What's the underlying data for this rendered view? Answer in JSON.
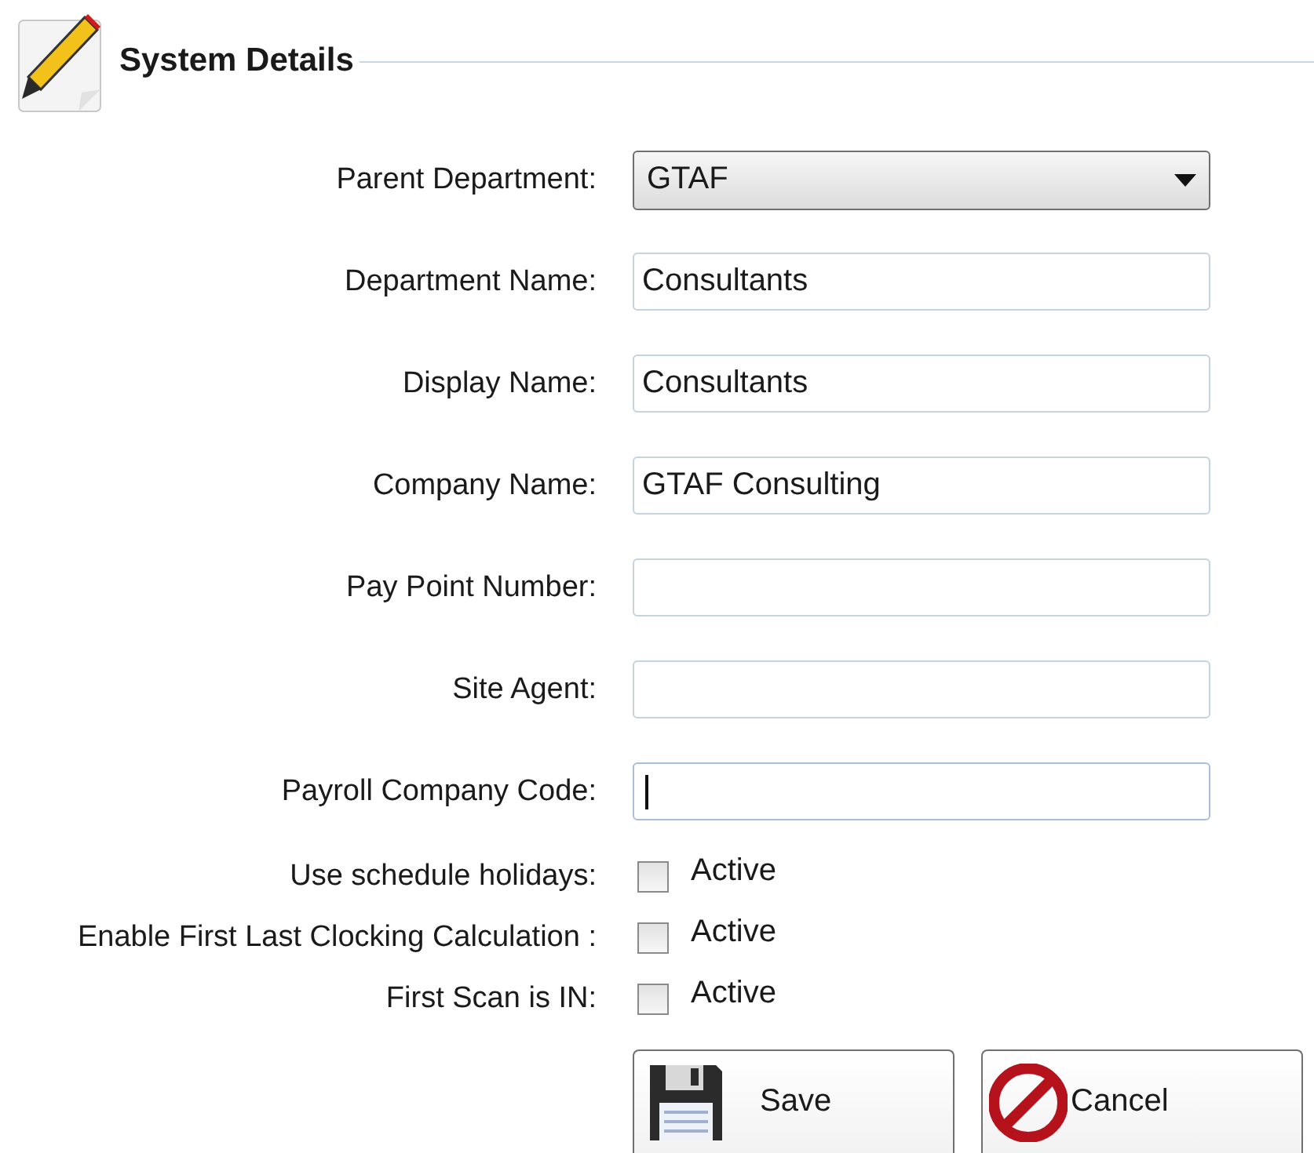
{
  "section": {
    "title": "System Details"
  },
  "fields": [
    {
      "label": "Parent Department:",
      "kind": "dropdown",
      "value": "GTAF"
    },
    {
      "label": "Department Name:",
      "kind": "text",
      "value": "Consultants"
    },
    {
      "label": "Display Name:",
      "kind": "text",
      "value": "Consultants"
    },
    {
      "label": "Company Name:",
      "kind": "text",
      "value": "GTAF Consulting"
    },
    {
      "label": "Pay Point Number:",
      "kind": "text"
    },
    {
      "label": "Site Agent:",
      "kind": "text"
    },
    {
      "label": "Payroll Company Code:",
      "kind": "text",
      "focused": true
    }
  ],
  "checkboxes": [
    {
      "label": "Use schedule holidays:",
      "text": "Active",
      "checked": false
    },
    {
      "label": "Enable First Last Clocking Calculation :",
      "text": "Active",
      "checked": false
    },
    {
      "label": "First Scan is IN:",
      "text": "Active",
      "checked": false
    }
  ],
  "buttons": [
    {
      "label": "Save",
      "kind": "save"
    },
    {
      "label": "Cancel",
      "kind": "cancel"
    }
  ]
}
